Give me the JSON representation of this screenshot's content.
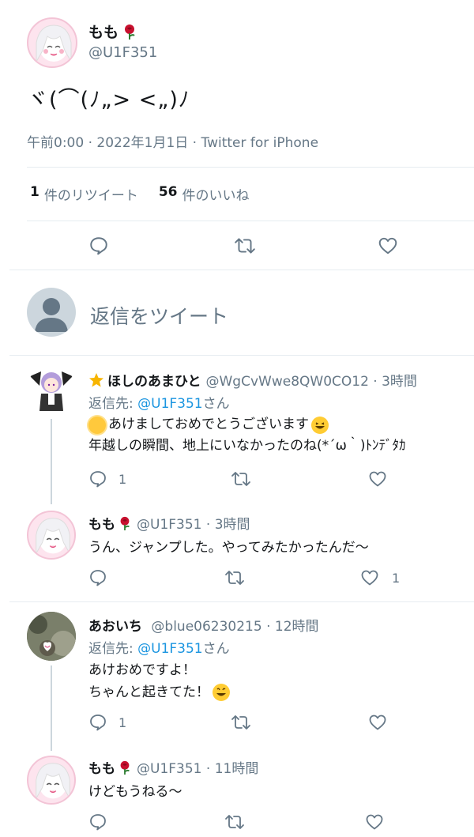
{
  "tweet": {
    "display_name": "もも",
    "handle": "@U1F351",
    "text": "ヾ(⌒(ﾉ„> <„)ﾉ",
    "meta": "午前0:00 · 2022年1月1日 · Twitter for iPhone",
    "retweet_count": "1",
    "retweet_label": "件のリツイート",
    "like_count": "56",
    "like_label": "件のいいね"
  },
  "compose": {
    "placeholder": "返信をツイート"
  },
  "replies": [
    {
      "name": "ほしのあまひと",
      "meta": "@WgCvWwe8QW0CO12 · 3時間",
      "reply_prefix": "返信先:",
      "reply_handle": "@U1F351",
      "reply_suffix": "さん",
      "line1": "あけましておめでとうございます",
      "line2": "年越しの瞬間、地上にいなかったのね(*´ω｀)ﾄﾝﾃﾞﾀｶ",
      "reply_count": "1"
    },
    {
      "name": "もも",
      "meta": "@U1F351 · 3時間",
      "line1": "うん、ジャンプした。やってみたかったんだ〜",
      "like_count": "1"
    },
    {
      "name": "あおいち",
      "meta": "@blue06230215 · 12時間",
      "reply_prefix": "返信先:",
      "reply_handle": "@U1F351",
      "reply_suffix": "さん",
      "line1": "あけおめですよ！",
      "line2": "ちゃんと起きてた！",
      "reply_count": "1"
    },
    {
      "name": "もも",
      "meta": "@U1F351 · 11時間",
      "line1": "けどもうねる〜"
    }
  ],
  "icons": {
    "reply": "reply-icon",
    "retweet": "retweet-icon",
    "like": "heart-icon",
    "rose": "rose-icon"
  },
  "colors": {
    "link": "#1b95e0",
    "muted": "#657786",
    "divider": "#e6ecf0",
    "action_icon": "#657786"
  }
}
